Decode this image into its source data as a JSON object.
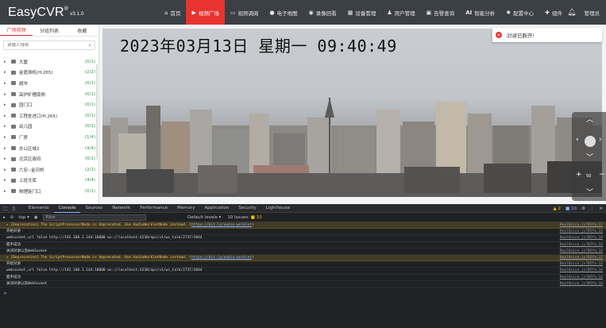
{
  "app": {
    "brand": "EasyCVR",
    "brand_mark": "®",
    "version": "v3.1.0"
  },
  "nav": {
    "items": [
      {
        "icon": "home-icon",
        "label": "首页"
      },
      {
        "icon": "video-icon",
        "label": "视频广场"
      },
      {
        "icon": "monitor-icon",
        "label": "视频调阅"
      },
      {
        "icon": "map-pin-icon",
        "label": "电子地图"
      },
      {
        "icon": "playback-icon",
        "label": "录像回看"
      },
      {
        "icon": "grid-icon",
        "label": "设备管理"
      },
      {
        "icon": "user-icon",
        "label": "用户管理"
      },
      {
        "icon": "lock-icon",
        "label": "告警查询"
      },
      {
        "icon": "ai-icon",
        "label": "智能分析"
      },
      {
        "icon": "gear-icon",
        "label": "配置中心"
      },
      {
        "icon": "puzzle-icon",
        "label": "组件"
      }
    ],
    "active_index": 1,
    "user_label": "管理员"
  },
  "left": {
    "tabs": [
      "广场视频",
      "分组列表",
      "收藏"
    ],
    "search_placeholder": "请输入搜索",
    "tree": [
      {
        "label": "大厦",
        "count": "(0/1)"
      },
      {
        "label": "金盾球机(H.265)",
        "count": "(2/2)"
      },
      {
        "label": "超市",
        "count": "(0/1)"
      },
      {
        "label": "高炉矿槽南侧",
        "count": "(0/1)"
      },
      {
        "label": "园门口",
        "count": "(0/1)"
      },
      {
        "label": "工程处进口(H.265)",
        "count": "(0/1)"
      },
      {
        "label": "幼儿园",
        "count": "(0/1)"
      },
      {
        "label": "厂房",
        "count": "(1/4)"
      },
      {
        "label": "办公区域2",
        "count": "(4/4)"
      },
      {
        "label": "北京区政府",
        "count": "(0/1)"
      },
      {
        "label": "六安--金河桥",
        "count": "(2/2)"
      },
      {
        "label": "上班文库",
        "count": "(4/4)"
      },
      {
        "label": "物理旋门口",
        "count": "(0/1)"
      }
    ]
  },
  "video": {
    "osd_text": "2023年03月13日  星期一  09:40:49",
    "alert_text": "对讲已断开!",
    "ptz_zoom": "50"
  },
  "devtools": {
    "tabs": [
      "Elements",
      "Console",
      "Sources",
      "Network",
      "Performance",
      "Memory",
      "Application",
      "Security",
      "Lighthouse"
    ],
    "active_tab": "Console",
    "warn_count": "2",
    "info_count": "10",
    "context": "top",
    "filter_placeholder": "Filter",
    "levels": "Default levels ▾",
    "issues_label": "10 Issues:",
    "issues_count": "10",
    "logs": [
      {
        "type": "warn",
        "text": "▸ [Deprecation] The ScriptProcessorNode is deprecated. Use AudioWorkletNode instead. (",
        "link": "https://bit.ly/audio-worklet",
        "tail": ")",
        "src": "RealVoice.js?05fa:17"
      },
      {
        "type": "log",
        "text": "开始对讲",
        "link": "",
        "tail": "",
        "src": "RealVoice.js?05fa:14"
      },
      {
        "type": "log",
        "text": "websocket_url false http://192.168.1.144:18000 ws://localhost:4230/api/v1/ws_talk/2737/2044",
        "link": "",
        "tail": "",
        "src": "RealVoice.js?05fa:14"
      },
      {
        "type": "log",
        "text": "握手成功",
        "link": "",
        "tail": "",
        "src": "RealVoice.js?05fa:14"
      },
      {
        "type": "log",
        "text": "关闭对讲以及WebSocket",
        "link": "",
        "tail": "",
        "src": "RealVoice.js?05fa:14"
      },
      {
        "type": "warn",
        "text": "▸ [Deprecation] The ScriptProcessorNode is deprecated. Use AudioWorkletNode instead. (",
        "link": "https://bit.ly/audio-worklet",
        "tail": ")",
        "src": "RealVoice.js?05fa:17"
      },
      {
        "type": "log",
        "text": "开始对讲",
        "link": "",
        "tail": "",
        "src": "RealVoice.js?05fa:14"
      },
      {
        "type": "log",
        "text": "websocket_url false http://192.168.1.144:18000 ws://localhost:4230/api/v1/ws_talk/2737/2044",
        "link": "",
        "tail": "",
        "src": "RealVoice.js?05fa:14"
      },
      {
        "type": "log",
        "text": "握手成功",
        "link": "",
        "tail": "",
        "src": "RealVoice.js?05fa:14"
      },
      {
        "type": "log",
        "text": "关闭对讲以及WebSocket",
        "link": "",
        "tail": "",
        "src": "RealVoice.js?05fa:14"
      }
    ],
    "prompt": ">"
  },
  "colors": {
    "accent": "#e8332e",
    "nav_bg": "#3b3f46",
    "devtools_bg": "#202124",
    "count_green": "#2a9d3b"
  }
}
